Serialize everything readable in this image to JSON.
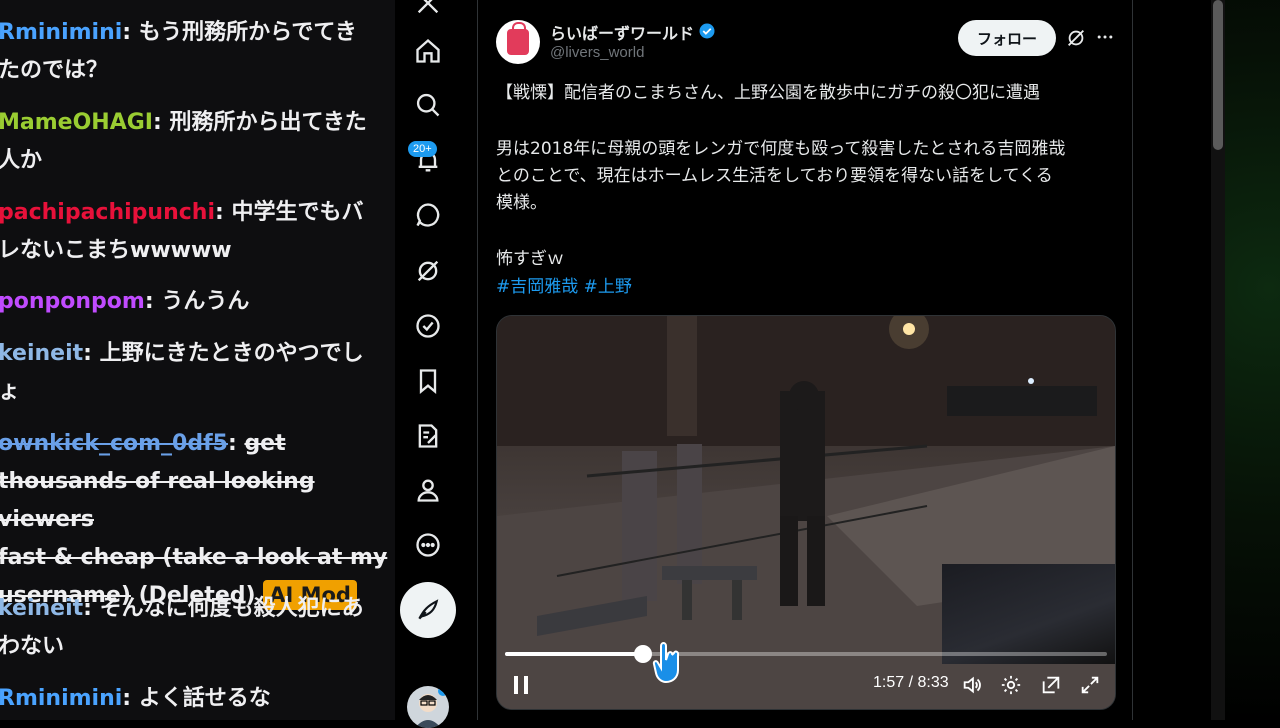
{
  "chat": {
    "messages": [
      {
        "user": "Rminimini",
        "color": "#4aa3ff",
        "text": "もう刑務所からでてき",
        "text2": "たのでは？"
      },
      {
        "user": "MameOHAGI",
        "color": "#9acd32",
        "text": "刑務所から出てきた",
        "text2": "人か"
      },
      {
        "user": "pachipachipunchi",
        "color": "#e8113a",
        "text": "中学生でもバ",
        "text2": "レないこまちwwwww"
      },
      {
        "user": "ponponpom",
        "color": "#c04bff",
        "text": "うんうん"
      },
      {
        "user": "keineit",
        "color": "#8fb8e6",
        "text": "上野にきたときのやつでし",
        "text2": "ょ"
      },
      {
        "user": "ownkick_com_0df5",
        "color": "#6aa0e8",
        "text": "get",
        "text2": "thousands of real looking viewers",
        "text3": "fast & cheap (take a look at my",
        "text4": "username)",
        "deleted": "(Deleted)",
        "badge": "AI Mod"
      },
      {
        "user": "keineit",
        "color": "#8fb8e6",
        "text": "そんなに何度も殺人犯にあ",
        "text2": "わない"
      },
      {
        "user": "Rminimini",
        "color": "#4aa3ff",
        "text": "よく話せるな"
      }
    ]
  },
  "nav": {
    "icons": [
      "x-logo-icon",
      "home-icon",
      "search-icon",
      "notifications-icon",
      "messages-icon",
      "grok-icon",
      "verified-orgs-icon",
      "bookmarks-icon",
      "articles-icon",
      "profile-icon",
      "more-icon"
    ],
    "notif_count": "20+"
  },
  "tweet": {
    "display_name": "らいばーずワールド",
    "handle": "@livers_world",
    "follow_label": "フォロー",
    "line1": "【戦慄】配信者のこまちさん、上野公園を散歩中にガチの殺〇犯に遭遇",
    "para2_l1": "男は2018年に母親の頭をレンガで何度も殴って殺害したとされる吉岡雅哉",
    "para2_l2": "とのことで、現在はホームレス生活をしており要領を得ない話をしてくる",
    "para2_l3": "模様。",
    "line3": "怖すぎｗ",
    "hashtag1": "#吉岡雅哉",
    "hashtag2": "#上野"
  },
  "video": {
    "time": "1:57 / 8:33",
    "progress": 0.23
  },
  "colors": {
    "accent": "#1d9bf0",
    "ai_mod_badge": "#f0a000"
  }
}
